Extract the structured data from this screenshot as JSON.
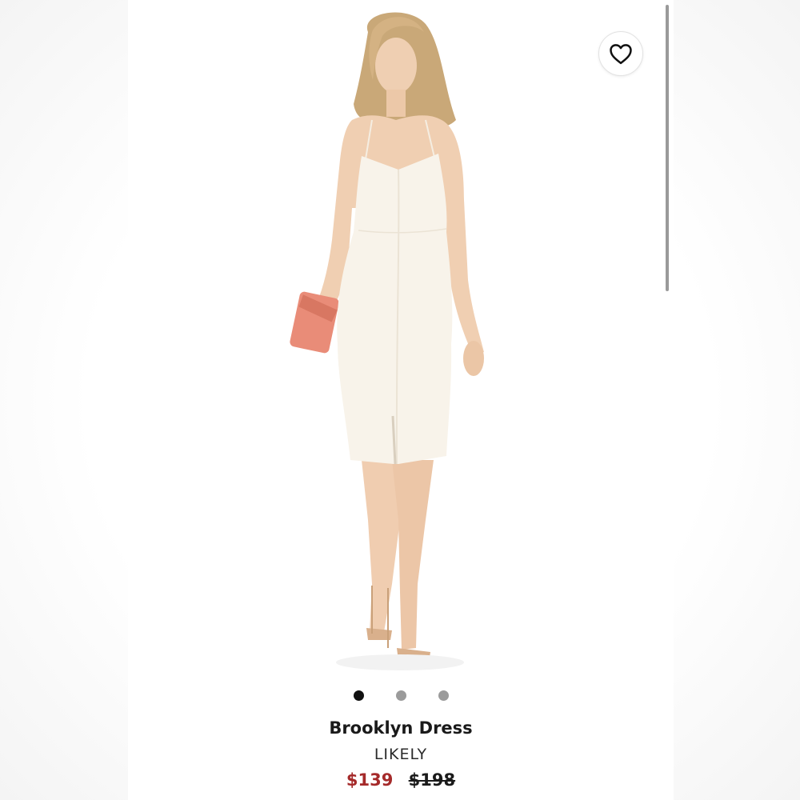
{
  "product": {
    "name": "Brooklyn Dress",
    "brand": "LIKELY",
    "sale_price": "$139",
    "original_price": "$198"
  },
  "image": {
    "alt": "Model wearing white midi dress holding pink clutch",
    "icon": "heart-icon",
    "total_images": 3,
    "current_index": 0
  },
  "colors": {
    "sale_price": "#a52a2a",
    "dot_active": "#111111",
    "dot_inactive": "#9b9b9b",
    "dress": "#f8f3ea",
    "clutch": "#e98c78"
  }
}
